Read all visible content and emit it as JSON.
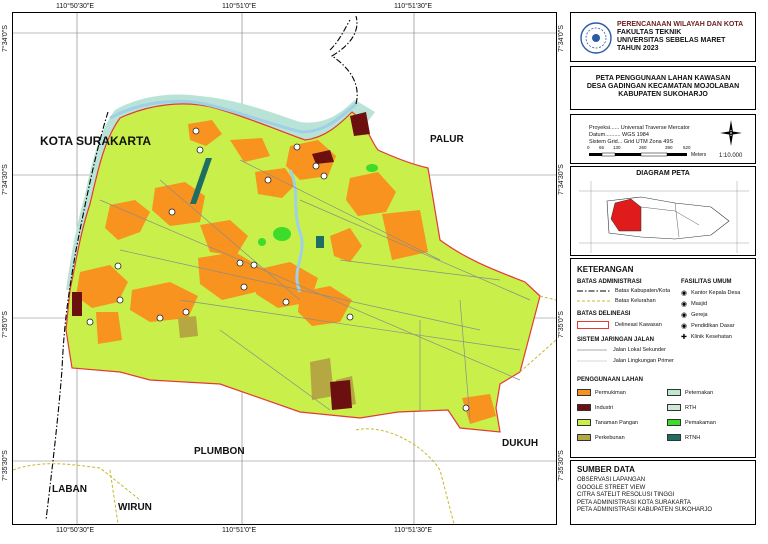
{
  "coords": {
    "top": [
      "110°50'30\"E",
      "110°51'0\"E",
      "110°51'30\"E"
    ],
    "bottom": [
      "110°50'30\"E",
      "110°51'0\"E",
      "110°51'30\"E"
    ],
    "left": [
      "7°34'0\"S",
      "7°34'30\"S",
      "7°35'0\"S",
      "7°35'30\"S"
    ],
    "right": [
      "7°34'0\"S",
      "7°34'30\"S",
      "7°35'0\"S",
      "7°35'30\"S"
    ]
  },
  "places": {
    "kota_surakarta": "KOTA SURAKARTA",
    "palur": "PALUR",
    "plumbon": "PLUMBON",
    "dukuh": "DUKUH",
    "laban": "LABAN",
    "wirun": "WIRUN"
  },
  "header": {
    "line1": "PERENCANAAN WILAYAH DAN KOTA",
    "line2": "FAKULTAS TEKNIK",
    "line3": "UNIVERSITAS SEBELAS MARET",
    "line4": "TAHUN 2023"
  },
  "title": {
    "line1": "PETA PENGGUNAAN LAHAN KAWASAN",
    "line2": "DESA GADINGAN KECAMATAN MOJOLABAN",
    "line3": "KABUPATEN SUKOHARJO"
  },
  "projection": {
    "proyeksi": "Proyeksi...... Universal Traverse Mercator",
    "datum": "Datum.......... WGS 1984",
    "sistem": "Sistem Grid... Grid UTM Zona 49S"
  },
  "scale": {
    "ticks": [
      "0",
      "65",
      "130",
      "260",
      "390",
      "520"
    ],
    "unit": "Meters",
    "ratio": "1:10.000"
  },
  "diagram": {
    "title": "DIAGRAM PETA"
  },
  "legend": {
    "title": "KETERANGAN",
    "batas_admin": "BATAS ADMINISTRASI",
    "batas_kab": "Batas Kabupaten/Kota",
    "batas_kel": "Batas Kelurahan",
    "batas_delineasi": "BATAS DELINEASI",
    "delineasi": "Delineasi Kawasan",
    "jaringan": "SISTEM JARINGAN JALAN",
    "jalan_sekunder": "Jalan Lokal Sekunder",
    "jalan_primer": "Jalan Lingkungan Primer",
    "fasilitas": "FASILITAS UMUM",
    "fasilitas_items": [
      "Kantor Kepala Desa",
      "Masjid",
      "Gereja",
      "Pendidikan Dasar",
      "Klinik Kesehatan"
    ],
    "penggunaan": "PENGGUNAAN LAHAN",
    "landuse_left": [
      "Permukiman",
      "Industri",
      "Tanaman Pangan",
      "Perkebunan"
    ],
    "landuse_right": [
      "Peternakan",
      "RTH",
      "Pemakaman",
      "RTNH"
    ],
    "colors": {
      "permukiman": "#f7931e",
      "industri": "#6b0f0f",
      "tanaman_pangan": "#c8ef4a",
      "perkebunan": "#b5a842",
      "peternakan": "#bfe6cf",
      "rth": "#cfe8d8",
      "pemakaman": "#3ddc2a",
      "rtnh": "#1f6e64"
    }
  },
  "sumber": {
    "title": "SUMBER DATA",
    "items": [
      "OBSERVASI LAPANGAN",
      "GOOGLE STREET VIEW",
      "CITRA SATELIT RESOLUSI TINGGI",
      "PETA ADMINISTRASI KOTA SURAKARTA",
      "PETA ADMINISTRASI KABUPATEN SUKOHARJO"
    ]
  }
}
